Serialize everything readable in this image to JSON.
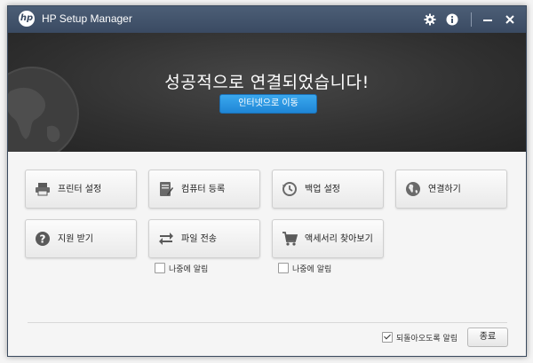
{
  "window": {
    "title": "HP Setup Manager",
    "logo_text": "hp"
  },
  "titlebar_icons": [
    "gear-icon",
    "info-icon",
    "minimize-icon",
    "close-icon"
  ],
  "hero": {
    "message": "성공적으로 연결되었습니다!",
    "button_label": "인터넷으로 이동"
  },
  "tiles": [
    {
      "label": "프린터 설정",
      "icon": "printer-icon"
    },
    {
      "label": "컴퓨터 등록",
      "icon": "register-icon"
    },
    {
      "label": "백업 설정",
      "icon": "backup-clock-icon"
    },
    {
      "label": "연결하기",
      "icon": "globe-icon"
    },
    {
      "label": "지원 받기",
      "icon": "help-icon"
    },
    {
      "label": "파일 전송",
      "icon": "transfer-arrows-icon"
    },
    {
      "label": "액세서리 찾아보기",
      "icon": "shopping-cart-icon"
    }
  ],
  "remind_later": {
    "file_transfer": "나중에 알림",
    "accessories": "나중에 알림"
  },
  "footer": {
    "remind_checkbox_label": "되돌아오도록 알림",
    "remind_checked": true,
    "close_button_label": "종료"
  },
  "colors": {
    "titlebar": "#41536b",
    "accent_button": "#2a95e2",
    "hero_background": "#333333"
  }
}
